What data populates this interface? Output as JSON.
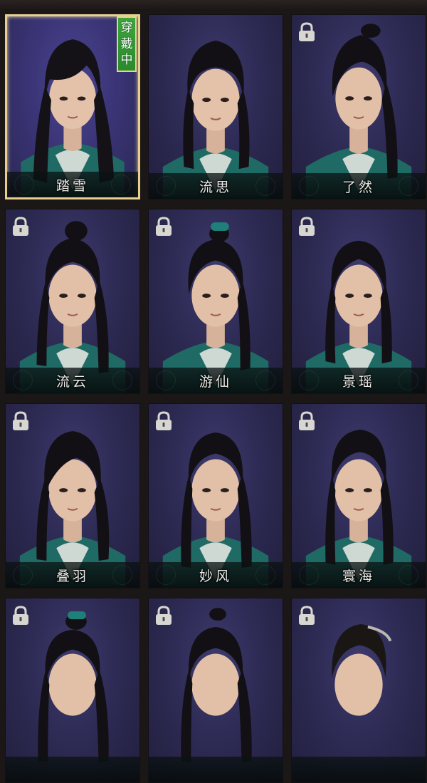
{
  "wearing_badge": {
    "chars": [
      "穿",
      "戴",
      "中"
    ]
  },
  "cards": [
    {
      "name": "踏雪",
      "locked": false,
      "selected": true
    },
    {
      "name": "流思",
      "locked": false,
      "selected": false
    },
    {
      "name": "了然",
      "locked": true,
      "selected": false
    },
    {
      "name": "流云",
      "locked": true,
      "selected": false
    },
    {
      "name": "游仙",
      "locked": true,
      "selected": false
    },
    {
      "name": "景瑶",
      "locked": true,
      "selected": false
    },
    {
      "name": "叠羽",
      "locked": true,
      "selected": false
    },
    {
      "name": "妙风",
      "locked": true,
      "selected": false
    },
    {
      "name": "寰海",
      "locked": true,
      "selected": false
    },
    {
      "name": "",
      "locked": true,
      "selected": false
    },
    {
      "name": "",
      "locked": true,
      "selected": false
    },
    {
      "name": "",
      "locked": true,
      "selected": false
    }
  ],
  "icons": {
    "lock": "lock-icon",
    "wearing": "wearing-badge"
  },
  "colors": {
    "card_bg": "#2e2b55",
    "selected_border": "#e6cf90",
    "badge_green": "#3da53c",
    "robe_teal": "#1f6a64",
    "name_text": "#ecebe6"
  }
}
